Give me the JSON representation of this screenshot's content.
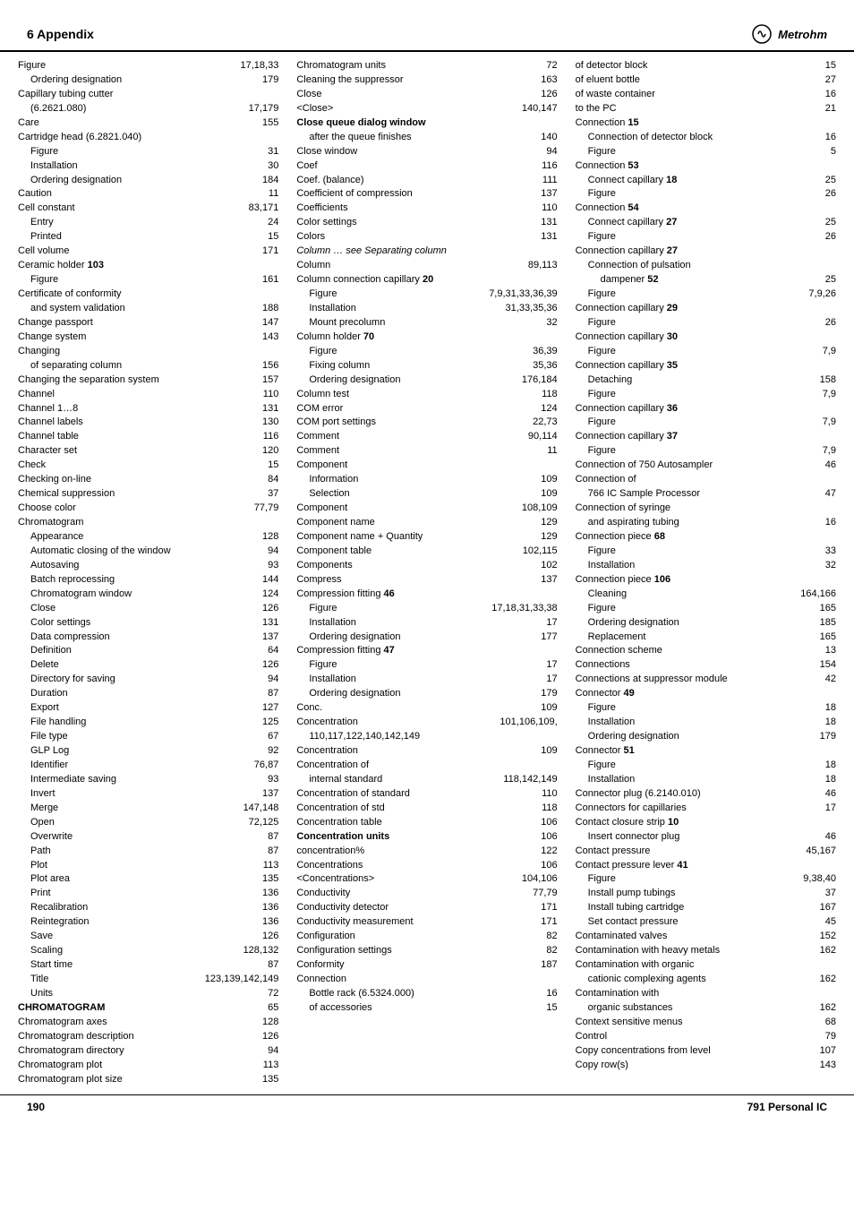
{
  "header": {
    "section": "6  Appendix",
    "logo": "Metrohm"
  },
  "footer": {
    "left_page": "190",
    "right_page": "791 Personal IC"
  },
  "col1": {
    "entries": [
      {
        "text": "Figure",
        "pages": "17,18,33",
        "indent": 0,
        "bold_label": false
      },
      {
        "text": "Ordering designation",
        "pages": "179",
        "indent": 1
      },
      {
        "text": "Capillary tubing cutter",
        "pages": "",
        "indent": 0
      },
      {
        "text": "(6.2621.080)",
        "pages": "17,179",
        "indent": 1
      },
      {
        "text": "Care",
        "pages": "155",
        "indent": 0
      },
      {
        "text": "Cartridge head (6.2821.040)",
        "pages": "",
        "indent": 0
      },
      {
        "text": "Figure",
        "pages": "31",
        "indent": 1
      },
      {
        "text": "Installation",
        "pages": "30",
        "indent": 1
      },
      {
        "text": "Ordering designation",
        "pages": "184",
        "indent": 1
      },
      {
        "text": "Caution",
        "pages": "11",
        "indent": 0
      },
      {
        "text": "Cell constant",
        "pages": "83,171",
        "indent": 0
      },
      {
        "text": "Entry",
        "pages": "24",
        "indent": 1
      },
      {
        "text": "Printed",
        "pages": "15",
        "indent": 1
      },
      {
        "text": "Cell volume",
        "pages": "171",
        "indent": 0
      },
      {
        "text": "Ceramic holder 103",
        "pages": "",
        "indent": 0,
        "bold_num": true
      },
      {
        "text": "Figure",
        "pages": "161",
        "indent": 1
      },
      {
        "text": "Certificate of conformity",
        "pages": "",
        "indent": 0
      },
      {
        "text": "and system validation",
        "pages": "188",
        "indent": 1
      },
      {
        "text": "Change passport",
        "pages": "147",
        "indent": 0
      },
      {
        "text": "Change system",
        "pages": "143",
        "indent": 0
      },
      {
        "text": "Changing",
        "pages": "",
        "indent": 0
      },
      {
        "text": "of separating column",
        "pages": "156",
        "indent": 1
      },
      {
        "text": "Changing the separation system",
        "pages": "157",
        "indent": 0
      },
      {
        "text": "Channel",
        "pages": "110",
        "indent": 0
      },
      {
        "text": "Channel 1…8",
        "pages": "131",
        "indent": 0
      },
      {
        "text": "Channel labels",
        "pages": "130",
        "indent": 0
      },
      {
        "text": "Channel table",
        "pages": "116",
        "indent": 0
      },
      {
        "text": "Character set",
        "pages": "120",
        "indent": 0
      },
      {
        "text": "Check",
        "pages": "15",
        "indent": 0
      },
      {
        "text": "Checking on-line",
        "pages": "84",
        "indent": 0
      },
      {
        "text": "Chemical suppression",
        "pages": "37",
        "indent": 0
      },
      {
        "text": "Choose color",
        "pages": "77,79",
        "indent": 0
      },
      {
        "text": "Chromatogram",
        "pages": "",
        "indent": 0
      },
      {
        "text": "Appearance",
        "pages": "128",
        "indent": 1
      },
      {
        "text": "Automatic closing of the window",
        "pages": "94",
        "indent": 1
      },
      {
        "text": "Autosaving",
        "pages": "93",
        "indent": 1
      },
      {
        "text": "Batch reprocessing",
        "pages": "144",
        "indent": 1
      },
      {
        "text": "Chromatogram window",
        "pages": "124",
        "indent": 1
      },
      {
        "text": "Close",
        "pages": "126",
        "indent": 1
      },
      {
        "text": "Color settings",
        "pages": "131",
        "indent": 1
      },
      {
        "text": "Data compression",
        "pages": "137",
        "indent": 1
      },
      {
        "text": "Definition",
        "pages": "64",
        "indent": 1
      },
      {
        "text": "Delete",
        "pages": "126",
        "indent": 1
      },
      {
        "text": "Directory for saving",
        "pages": "94",
        "indent": 1
      },
      {
        "text": "Duration",
        "pages": "87",
        "indent": 1
      },
      {
        "text": "Export",
        "pages": "127",
        "indent": 1
      },
      {
        "text": "File handling",
        "pages": "125",
        "indent": 1
      },
      {
        "text": "File type",
        "pages": "67",
        "indent": 1
      },
      {
        "text": "GLP Log",
        "pages": "92",
        "indent": 1
      },
      {
        "text": "Identifier",
        "pages": "76,87",
        "indent": 1
      },
      {
        "text": "Intermediate saving",
        "pages": "93",
        "indent": 1
      },
      {
        "text": "Invert",
        "pages": "137",
        "indent": 1
      },
      {
        "text": "Merge",
        "pages": "147,148",
        "indent": 1
      },
      {
        "text": "Open",
        "pages": "72,125",
        "indent": 1
      },
      {
        "text": "Overwrite",
        "pages": "87",
        "indent": 1
      },
      {
        "text": "Path",
        "pages": "87",
        "indent": 1
      },
      {
        "text": "Plot",
        "pages": "113",
        "indent": 1
      },
      {
        "text": "Plot area",
        "pages": "135",
        "indent": 1
      },
      {
        "text": "Print",
        "pages": "136",
        "indent": 1
      },
      {
        "text": "Recalibration",
        "pages": "136",
        "indent": 1
      },
      {
        "text": "Reintegration",
        "pages": "136",
        "indent": 1
      },
      {
        "text": "Save",
        "pages": "126",
        "indent": 1
      },
      {
        "text": "Scaling",
        "pages": "128,132",
        "indent": 1
      },
      {
        "text": "Start time",
        "pages": "87",
        "indent": 1
      },
      {
        "text": "Title",
        "pages": "123,139,142,149",
        "indent": 1
      },
      {
        "text": "Units",
        "pages": "72",
        "indent": 1
      },
      {
        "text": "CHROMATOGRAM",
        "pages": "65",
        "indent": 0,
        "bold": true
      },
      {
        "text": "Chromatogram axes",
        "pages": "128",
        "indent": 0
      },
      {
        "text": "Chromatogram description",
        "pages": "126",
        "indent": 0
      },
      {
        "text": "Chromatogram directory",
        "pages": "94",
        "indent": 0
      },
      {
        "text": "Chromatogram plot",
        "pages": "113",
        "indent": 0
      },
      {
        "text": "Chromatogram plot size",
        "pages": "135",
        "indent": 0
      }
    ]
  },
  "col2": {
    "entries": [
      {
        "text": "Chromatogram units",
        "pages": "72"
      },
      {
        "text": "Cleaning the suppressor",
        "pages": "163"
      },
      {
        "text": "Close",
        "pages": "126"
      },
      {
        "text": "<Close>",
        "pages": "140,147"
      },
      {
        "text": "Close queue dialog window",
        "pages": "",
        "bold": true
      },
      {
        "text": "after the queue finishes",
        "pages": "140",
        "indent": 1
      },
      {
        "text": "Close window",
        "pages": "94"
      },
      {
        "text": "Coef",
        "pages": "116"
      },
      {
        "text": "Coef. (balance)",
        "pages": "111"
      },
      {
        "text": "Coefficient of compression",
        "pages": "137"
      },
      {
        "text": "Coefficients",
        "pages": "110"
      },
      {
        "text": "Color settings",
        "pages": "131"
      },
      {
        "text": "Colors",
        "pages": "131"
      },
      {
        "text": "Column … see Separating column",
        "pages": "",
        "italic": true
      },
      {
        "text": "Column",
        "pages": "89,113"
      },
      {
        "text": "Column connection capillary 20",
        "pages": "",
        "bold_num": true
      },
      {
        "text": "Figure",
        "pages": "7,9,31,33,36,39",
        "indent": 1
      },
      {
        "text": "Installation",
        "pages": "31,33,35,36",
        "indent": 1
      },
      {
        "text": "Mount precolumn",
        "pages": "32",
        "indent": 1
      },
      {
        "text": "Column holder 70",
        "pages": "",
        "bold_num": true
      },
      {
        "text": "Figure",
        "pages": "36,39",
        "indent": 1
      },
      {
        "text": "Fixing column",
        "pages": "35,36",
        "indent": 1
      },
      {
        "text": "Ordering designation",
        "pages": "176,184",
        "indent": 1
      },
      {
        "text": "Column test",
        "pages": "118"
      },
      {
        "text": "COM error",
        "pages": "124"
      },
      {
        "text": "COM port settings",
        "pages": "22,73"
      },
      {
        "text": "Comment",
        "pages": "90,114"
      },
      {
        "text": "Comment",
        "pages": "11"
      },
      {
        "text": "Component",
        "pages": "",
        "bold": false
      },
      {
        "text": "Information",
        "pages": "109",
        "indent": 1
      },
      {
        "text": "Selection",
        "pages": "109",
        "indent": 1
      },
      {
        "text": "Component",
        "pages": "108,109"
      },
      {
        "text": "Component name",
        "pages": "129"
      },
      {
        "text": "Component name + Quantity",
        "pages": "129"
      },
      {
        "text": "Component table",
        "pages": "102,115"
      },
      {
        "text": "Components",
        "pages": "102"
      },
      {
        "text": "Compress",
        "pages": "137"
      },
      {
        "text": "Compression fitting 46",
        "pages": "",
        "bold_num": true
      },
      {
        "text": "Figure",
        "pages": "17,18,31,33,38",
        "indent": 1
      },
      {
        "text": "Installation",
        "pages": "17",
        "indent": 1
      },
      {
        "text": "Ordering designation",
        "pages": "177",
        "indent": 1
      },
      {
        "text": "Compression fitting 47",
        "pages": "",
        "bold_num": true
      },
      {
        "text": "Figure",
        "pages": "17",
        "indent": 1
      },
      {
        "text": "Installation",
        "pages": "17",
        "indent": 1
      },
      {
        "text": "Ordering designation",
        "pages": "179",
        "indent": 1
      },
      {
        "text": "Conc.",
        "pages": "109"
      },
      {
        "text": "Concentration",
        "pages": "101,106,109,"
      },
      {
        "text": "110,117,122,140,142,149",
        "pages": "",
        "indent": 1,
        "continued": true
      },
      {
        "text": "Concentration",
        "pages": "109"
      },
      {
        "text": "Concentration of",
        "pages": ""
      },
      {
        "text": "internal standard",
        "pages": "118,142,149",
        "indent": 1
      },
      {
        "text": "Concentration of standard",
        "pages": "110"
      },
      {
        "text": "Concentration of std",
        "pages": "118"
      },
      {
        "text": "Concentration table",
        "pages": "106"
      },
      {
        "text": "Concentration units",
        "pages": "106",
        "bold": true
      },
      {
        "text": "concentration%",
        "pages": "122"
      },
      {
        "text": "Concentrations",
        "pages": "106"
      },
      {
        "text": "<Concentrations>",
        "pages": "104,106"
      },
      {
        "text": "Conductivity",
        "pages": "77,79"
      },
      {
        "text": "Conductivity detector",
        "pages": "171"
      },
      {
        "text": "Conductivity measurement",
        "pages": "171"
      },
      {
        "text": "Configuration",
        "pages": "82"
      },
      {
        "text": "Configuration settings",
        "pages": "82"
      },
      {
        "text": "Conformity",
        "pages": "187"
      },
      {
        "text": "Connection",
        "pages": ""
      },
      {
        "text": "Bottle rack (6.5324.000)",
        "pages": "16",
        "indent": 1
      },
      {
        "text": "of accessories",
        "pages": "15",
        "indent": 1
      }
    ]
  },
  "col3": {
    "entries": [
      {
        "text": "of detector block",
        "pages": "15"
      },
      {
        "text": "of eluent bottle",
        "pages": "27"
      },
      {
        "text": "of waste container",
        "pages": "16"
      },
      {
        "text": "to the PC",
        "pages": "21"
      },
      {
        "text": "Connection 15",
        "pages": "",
        "bold_num": true
      },
      {
        "text": "Connection of detector block",
        "pages": "16",
        "indent": 1
      },
      {
        "text": "Figure",
        "pages": "5",
        "indent": 1
      },
      {
        "text": "Connection 53",
        "pages": "",
        "bold_num": true
      },
      {
        "text": "Connect capillary 18",
        "pages": "25",
        "indent": 1,
        "bold_num_inline": true
      },
      {
        "text": "Figure",
        "pages": "26",
        "indent": 1
      },
      {
        "text": "Connection 54",
        "pages": "",
        "bold_num": true
      },
      {
        "text": "Connect capillary 27",
        "pages": "25",
        "indent": 1,
        "bold_num_inline": true
      },
      {
        "text": "Figure",
        "pages": "26",
        "indent": 1
      },
      {
        "text": "Connection capillary 27",
        "pages": "",
        "bold_num": true
      },
      {
        "text": "Connection of pulsation",
        "pages": "",
        "indent": 1
      },
      {
        "text": "dampener 52",
        "pages": "25",
        "indent": 2,
        "bold_num_inline": true
      },
      {
        "text": "Figure",
        "pages": "7,9,26",
        "indent": 1
      },
      {
        "text": "Connection capillary 29",
        "pages": "",
        "bold_num": true
      },
      {
        "text": "Figure",
        "pages": "26",
        "indent": 1
      },
      {
        "text": "Connection capillary 30",
        "pages": "",
        "bold_num": true
      },
      {
        "text": "Figure",
        "pages": "7,9",
        "indent": 1
      },
      {
        "text": "Connection capillary 35",
        "pages": "",
        "bold_num": true
      },
      {
        "text": "Detaching",
        "pages": "158",
        "indent": 1
      },
      {
        "text": "Figure",
        "pages": "7,9",
        "indent": 1
      },
      {
        "text": "Connection capillary 36",
        "pages": "",
        "bold_num": true
      },
      {
        "text": "Figure",
        "pages": "7,9",
        "indent": 1
      },
      {
        "text": "Connection capillary 37",
        "pages": "",
        "bold_num": true
      },
      {
        "text": "Figure",
        "pages": "7,9",
        "indent": 1
      },
      {
        "text": "Connection of 750 Autosampler",
        "pages": "46"
      },
      {
        "text": "Connection of",
        "pages": ""
      },
      {
        "text": "766 IC Sample Processor",
        "pages": "47",
        "indent": 1
      },
      {
        "text": "Connection of syringe",
        "pages": ""
      },
      {
        "text": "and aspirating tubing",
        "pages": "16",
        "indent": 1
      },
      {
        "text": "Connection piece 68",
        "pages": "",
        "bold_num": true
      },
      {
        "text": "Figure",
        "pages": "33",
        "indent": 1
      },
      {
        "text": "Installation",
        "pages": "32",
        "indent": 1
      },
      {
        "text": "Connection piece 106",
        "pages": "",
        "bold_num": true
      },
      {
        "text": "Cleaning",
        "pages": "164,166",
        "indent": 1
      },
      {
        "text": "Figure",
        "pages": "165",
        "indent": 1
      },
      {
        "text": "Ordering designation",
        "pages": "185",
        "indent": 1
      },
      {
        "text": "Replacement",
        "pages": "165",
        "indent": 1
      },
      {
        "text": "Connection scheme",
        "pages": "13"
      },
      {
        "text": "Connections",
        "pages": "154"
      },
      {
        "text": "Connections at suppressor module",
        "pages": "42"
      },
      {
        "text": "Connector 49",
        "pages": "",
        "bold_num": true
      },
      {
        "text": "Figure",
        "pages": "18",
        "indent": 1
      },
      {
        "text": "Installation",
        "pages": "18",
        "indent": 1
      },
      {
        "text": "Ordering designation",
        "pages": "179",
        "indent": 1
      },
      {
        "text": "Connector 51",
        "pages": "",
        "bold_num": true
      },
      {
        "text": "Figure",
        "pages": "18",
        "indent": 1
      },
      {
        "text": "Installation",
        "pages": "18",
        "indent": 1
      },
      {
        "text": "Connector plug (6.2140.010)",
        "pages": "46"
      },
      {
        "text": "Connectors for capillaries",
        "pages": "17"
      },
      {
        "text": "Contact closure strip 10",
        "pages": "",
        "bold_num": true
      },
      {
        "text": "Insert connector plug",
        "pages": "46",
        "indent": 1
      },
      {
        "text": "Contact pressure",
        "pages": "45,167"
      },
      {
        "text": "Contact pressure lever 41",
        "pages": "",
        "bold_num": true
      },
      {
        "text": "Figure",
        "pages": "9,38,40",
        "indent": 1
      },
      {
        "text": "Install pump tubings",
        "pages": "37",
        "indent": 1
      },
      {
        "text": "Install tubing cartridge",
        "pages": "167",
        "indent": 1
      },
      {
        "text": "Set contact pressure",
        "pages": "45",
        "indent": 1
      },
      {
        "text": "Contaminated valves",
        "pages": "152"
      },
      {
        "text": "Contamination with heavy metals",
        "pages": "162"
      },
      {
        "text": "Contamination with organic",
        "pages": ""
      },
      {
        "text": "cationic complexing agents",
        "pages": "162",
        "indent": 1
      },
      {
        "text": "Contamination with",
        "pages": ""
      },
      {
        "text": "organic substances",
        "pages": "162",
        "indent": 1
      },
      {
        "text": "Context sensitive menus",
        "pages": "68"
      },
      {
        "text": "Control",
        "pages": "79"
      },
      {
        "text": "Copy concentrations from level",
        "pages": "107"
      },
      {
        "text": "Copy row(s)",
        "pages": "143"
      }
    ]
  }
}
